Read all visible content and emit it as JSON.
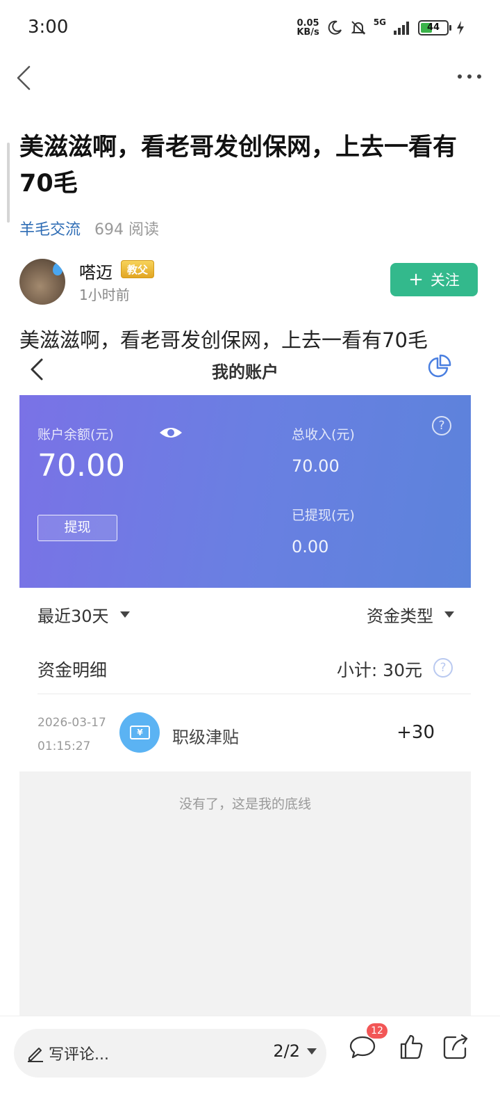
{
  "status_bar": {
    "time": "3:00",
    "net_speed_value": "0.05",
    "net_speed_unit": "KB/s",
    "signal": "5G",
    "battery": "44"
  },
  "article": {
    "title": "美滋滋啊，看老哥发创保网，上去一看有70毛",
    "category": "羊毛交流",
    "reads": "694 阅读",
    "author": {
      "name": "嗒迈",
      "badge": "教父",
      "time": "1小时前",
      "follow_label": "关注"
    },
    "body_text": "美滋滋啊，看老哥发创保网，上去一看有70毛"
  },
  "embedded": {
    "title": "我的账户",
    "balance_label": "账户余额(元)",
    "balance_value": "70.00",
    "total_income_label": "总收入(元)",
    "total_income_value": "70.00",
    "withdrawn_label": "已提现(元)",
    "withdrawn_value": "0.00",
    "withdraw_button": "提现",
    "filter_period": "最近30天",
    "filter_type": "资金类型",
    "detail_title": "资金明细",
    "subtotal": "小计: 30元",
    "transactions": [
      {
        "date": "2026-03-17",
        "time": "01:15:27",
        "icon_text": "¥",
        "name": "职级津贴",
        "amount": "+30"
      }
    ],
    "end_text": "没有了，这是我的底线"
  },
  "bottom_bar": {
    "comment_placeholder": "写评论...",
    "page_indicator": "2/2",
    "comment_count": "12"
  },
  "colors": {
    "accent_green": "#33b98c",
    "link_blue": "#2f6db5",
    "card_gradient_start": "#7a72e6",
    "card_gradient_end": "#5c83db"
  }
}
